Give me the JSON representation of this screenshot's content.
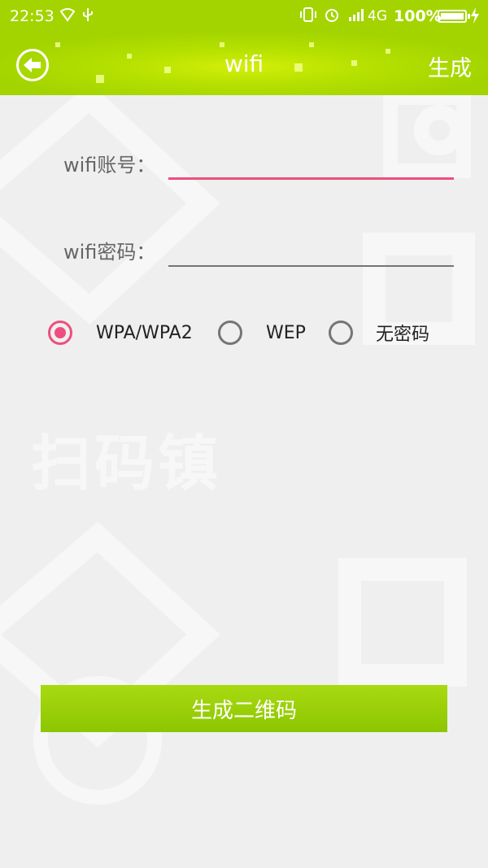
{
  "status_bar": {
    "time": "22:53",
    "network": "4G",
    "battery_percent": "100%",
    "icons": [
      "wifi-icon",
      "usb-icon",
      "vibrate-icon",
      "alarm-icon",
      "signal-icon",
      "battery-icon",
      "charging-icon"
    ]
  },
  "titlebar": {
    "title": "wifi",
    "action_label": "生成",
    "back_icon": "back-arrow-icon"
  },
  "watermark_text": "扫码镇",
  "form": {
    "ssid_label": "wifi账号：",
    "ssid_value": "",
    "password_label": "wifi密码：",
    "password_value": ""
  },
  "encryption": {
    "options": [
      "WPA/WPA2",
      "WEP",
      "无密码"
    ],
    "selected": "WPA/WPA2"
  },
  "generate_button": "生成二维码",
  "colors": {
    "brand_green": "#a3d400",
    "accent_pink": "#ee4e7f",
    "background": "#efefef"
  }
}
